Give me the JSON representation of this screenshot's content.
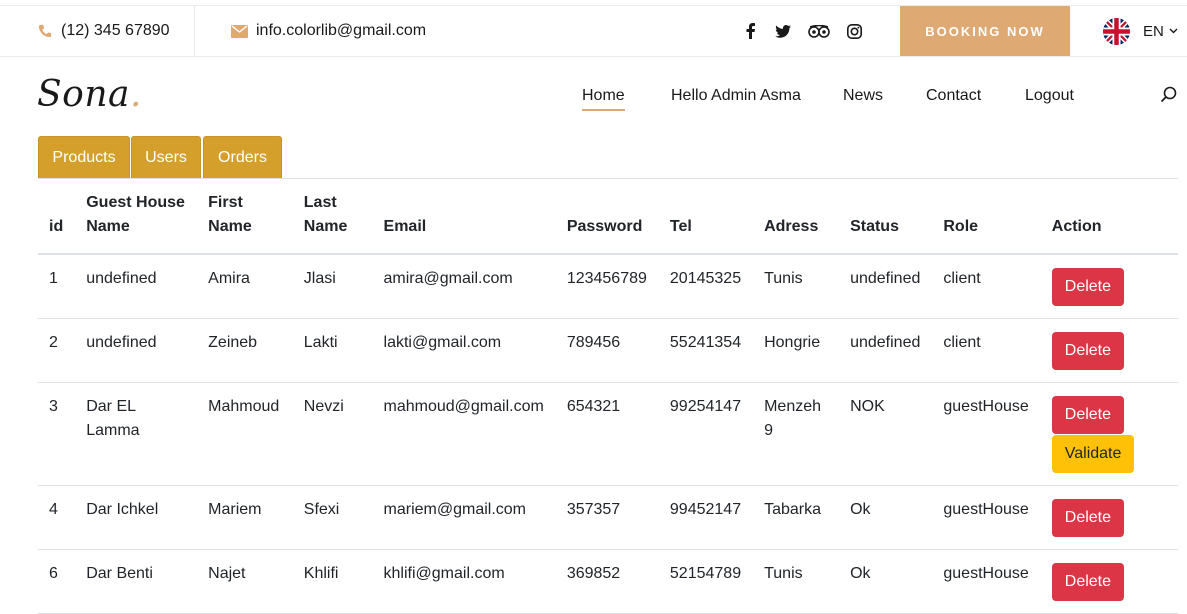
{
  "topbar": {
    "phone": "(12) 345 67890",
    "email": "info.colorlib@gmail.com",
    "booking": "BOOKING NOW",
    "lang": "EN"
  },
  "colors": {
    "accent": "#dfa974",
    "tab": "#d4a02b",
    "delete": "#dc3545",
    "validate": "#ffc107"
  },
  "logo": {
    "text": "Sona",
    "dot": "."
  },
  "nav": {
    "home": "Home",
    "hello": "Hello Admin Asma",
    "news": "News",
    "contact": "Contact",
    "logout": "Logout"
  },
  "tabs": {
    "products": "Products",
    "users": "Users",
    "orders": "Orders"
  },
  "table": {
    "headers": {
      "id": "id",
      "gh1": "Guest House",
      "gh2": "Name",
      "fn1": "First",
      "fn2": "Name",
      "ln1": "Last",
      "ln2": "Name",
      "email": "Email",
      "password": "Password",
      "tel": "Tel",
      "adress": "Adress",
      "status": "Status",
      "role": "Role",
      "action": "Action"
    },
    "rows": [
      {
        "id": "1",
        "gh": "undefined",
        "first": "Amira",
        "last": "Jlasi",
        "email": "amira@gmail.com",
        "password": "123456789",
        "tel": "20145325",
        "adress": "Tunis",
        "status": "undefined",
        "role": "client"
      },
      {
        "id": "2",
        "gh": "undefined",
        "first": "Zeineb",
        "last": "Lakti",
        "email": "lakti@gmail.com",
        "password": "789456",
        "tel": "55241354",
        "adress": "Hongrie",
        "status": "undefined",
        "role": "client"
      },
      {
        "id": "3",
        "gh": "Dar EL Lamma",
        "first": "Mahmoud",
        "last": "Nevzi",
        "email": "mahmoud@gmail.com",
        "password": "654321",
        "tel": "99254147",
        "adress": "Menzeh 9",
        "status": "NOK",
        "role": "guestHouse"
      },
      {
        "id": "4",
        "gh": "Dar Ichkel",
        "first": "Mariem",
        "last": "Sfexi",
        "email": "mariem@gmail.com",
        "password": "357357",
        "tel": "99452147",
        "adress": "Tabarka",
        "status": "Ok",
        "role": "guestHouse"
      },
      {
        "id": "6",
        "gh": "Dar Benti",
        "first": "Najet",
        "last": "Khlifi",
        "email": "khlifi@gmail.com",
        "password": "369852",
        "tel": "52154789",
        "adress": "Tunis",
        "status": "Ok",
        "role": "guestHouse"
      }
    ],
    "delete_label": "Delete",
    "validate_label": "Validate"
  }
}
